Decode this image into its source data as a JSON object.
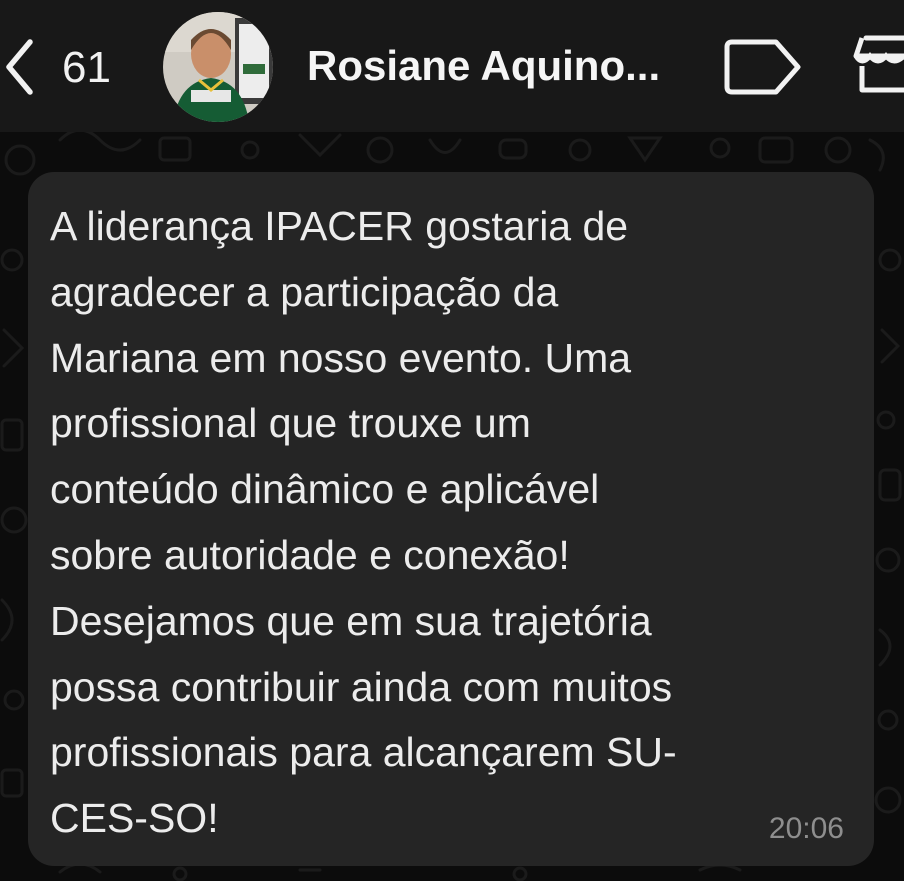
{
  "header": {
    "unread_count": "61",
    "contact_name": "Rosiane Aquino...",
    "icons": {
      "back": "chevron-left-icon",
      "label": "label-tag-icon",
      "store": "storefront-icon"
    }
  },
  "message": {
    "text": "A liderança IPACER gostaria de\nagradecer a participação da\nMariana em nosso evento. Uma\nprofissional que trouxe um\nconteúdo dinâmico e aplicável\nsobre autoridade e conexão!\nDesejamos que em sua trajetória\npossa contribuir ainda com muitos\nprofissionais para alcançarem SU-\nCES-SO!",
    "time": "20:06"
  },
  "colors": {
    "background": "#0c0c0c",
    "header": "#181818",
    "bubble": "#252525",
    "text": "#ececec",
    "timestamp": "#8e8e8e"
  }
}
